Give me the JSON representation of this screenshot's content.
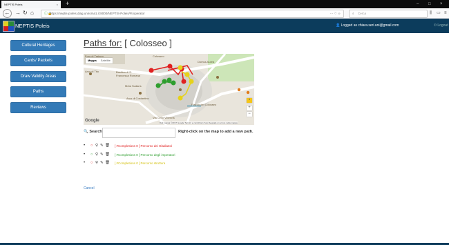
{
  "browser": {
    "tab_title": "NEPTIS Poleis",
    "tab_close": "×",
    "new_tab": "+",
    "url": "https://neptis-poleis.diag.uniroma1.it:8000/NEPTIS-Poleis/#!/operator",
    "url_actions": "··· ♡ ☆",
    "search_placeholder": "Cerca",
    "win_minimize": "–",
    "win_maximize": "□",
    "win_close": "×"
  },
  "app": {
    "brand": "NEPTIS Poleis",
    "user_text": "Logged as chiara.seri.uni@gmail.com",
    "logout": "Logout"
  },
  "sidebar": {
    "items": [
      {
        "label": "Cultural Heritages"
      },
      {
        "label": "Cards/ Packets"
      },
      {
        "label": "Draw Validity Areas"
      },
      {
        "label": "Paths"
      },
      {
        "label": "Reviews"
      }
    ]
  },
  "main": {
    "title_prefix": "Paths for:",
    "title_value": "[ Colosseo ]",
    "search_label": "Search:",
    "hint": "Right-click on the map to add a new path.",
    "cancel": "Cancel"
  },
  "map": {
    "type_map": "Mappa",
    "type_sat": "Satellite",
    "google": "Google",
    "credits": "Dati mappa ©2017 Google   Termini e condizioni d'uso   Segnala un errore nella mappa",
    "labels": [
      "Basilica di S. Francesca Romana",
      "Colosseo",
      "Foro di Traiano",
      "Arco di Tito",
      "Meta Sudans",
      "Arco di Costantino",
      "Via Celio Vibenna",
      "Piazza del Colosseo",
      "Domus Aurea"
    ],
    "zoom_in": "+",
    "zoom_out": "−"
  },
  "paths": [
    {
      "label": "[ #Completions 0 ] Percorso dei Gladiatori",
      "color": "#e02020"
    },
    {
      "label": "[ #Completions 0 ] Percorso degli imperatori",
      "color": "#2e9e2e"
    },
    {
      "label": "[ #Completions 0 ] Percorso struttura",
      "color": "#e6d21a"
    }
  ],
  "colors": {
    "navy": "#0c3c5c",
    "button": "#337ab7"
  }
}
